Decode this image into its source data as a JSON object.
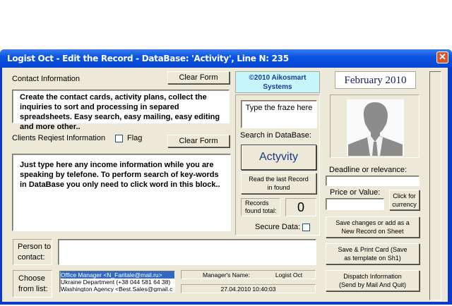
{
  "window": {
    "title": "Logist Oct - Edit the Record - DataBase:  'Activity',  Line N: 235",
    "close_icon": "close-icon"
  },
  "contact": {
    "label": "Contact Information",
    "clear_label": "Clear Form",
    "text": "Create the contact cards, activity plans, collect the inquiries to sort and processing in separed spreadsheets. Easy search, easy mailing, easy editing and more other.."
  },
  "request": {
    "label": "Clients Reqiest Information",
    "flag_label": "Flag",
    "clear_label": "Clear Form",
    "text": "Just type here any income information while you are speaking by telefone. To perform search of key-words in DataBase you only need to click word in this block.."
  },
  "brand": {
    "copyright": "©2010 Aikosmart Systems",
    "month": "February 2010",
    "brand_color": "#c6f6fc"
  },
  "search": {
    "input_value": "Type the fraze here",
    "label": "Search in DataBase:",
    "database_button": "Actyvity",
    "read_last": "Read the last Record in found",
    "records_label": "Records found total:",
    "records_count": "0",
    "secure_label": "Secure Data:"
  },
  "right": {
    "deadline_label": "Deadline or relevance:",
    "deadline_value": "",
    "price_label": "Price or Value:",
    "price_value": "",
    "currency_button": "Click for currency",
    "save_button": "Save changes or add as a New Record on Sheet",
    "print_button": "Save & Print Card (Save as template on Sh1)",
    "dispatch_button": "Dispatch Information (Send by Mail And Quit)"
  },
  "person": {
    "label": "Person to contact:",
    "value": ""
  },
  "choose": {
    "label": "Choose from list:",
    "items": [
      "Office Manager <N_Faritale@mail.ru>",
      "Ukraine Department (+38 044 581 64 38)",
      "Washington Agency <Best.Sales@gmail.c"
    ],
    "selected_index": 0
  },
  "status": {
    "manager_label": "Manager's Name:",
    "manager_value": "Logist Oct",
    "datetime": "27.04.2010 10:40:03"
  }
}
